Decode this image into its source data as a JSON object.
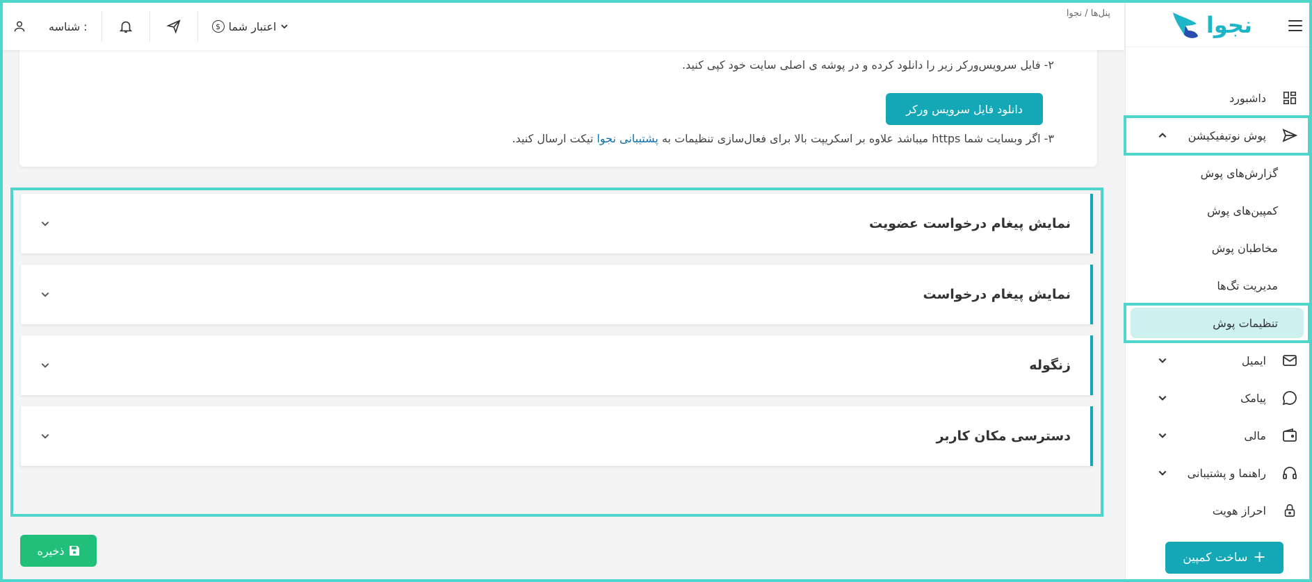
{
  "brand": {
    "logo_text": "نجوا",
    "accent": "#14a8b7",
    "outline": "#4fd6cc",
    "save_color": "#20c07a"
  },
  "topbar": {
    "breadcrumb": "پنل‌ها / نجوا",
    "id_label": "شناسه :",
    "credit_label": "اعتبار شما",
    "icons": [
      "user-icon",
      "bell-icon",
      "send-icon",
      "coin-icon",
      "chevron-down-icon"
    ]
  },
  "sidebar": {
    "items": [
      {
        "label": "داشبورد",
        "icon": "dashboard-icon"
      },
      {
        "label": "پوش نوتیفیکیشن",
        "icon": "send-icon",
        "expanded": true
      },
      {
        "label": "گزارش‌های پوش"
      },
      {
        "label": "کمپین‌های پوش"
      },
      {
        "label": "مخاطبان پوش"
      },
      {
        "label": "مدیریت تگ‌ها"
      },
      {
        "label": "تنظیمات پوش",
        "active": true
      },
      {
        "label": "ایمیل",
        "icon": "mail-icon"
      },
      {
        "label": "پیامک",
        "icon": "chat-icon"
      },
      {
        "label": "مالی",
        "icon": "wallet-icon"
      },
      {
        "label": "راهنما و پشتیبانی",
        "icon": "headset-icon"
      },
      {
        "label": "احراز هویت",
        "icon": "lock-icon"
      }
    ],
    "create_campaign": "ساخت کمپین"
  },
  "info": {
    "step2": "۲- فایل سرویس‌ورکر زیر را دانلود کرده و در پوشه ی اصلی سایت خود کپی کنید.",
    "download_button": "دانلود فایل سرویس ورکر",
    "step3_before": "۳- اگر وبسایت شما https میباشد علاوه بر اسکریپت بالا برای فعال‌سازی تنظیمات به",
    "step3_link": "پشتیبانی نجوا",
    "step3_after": "تیکت ارسال کنید."
  },
  "accordions": [
    {
      "title": "نمایش پیغام درخواست عضویت"
    },
    {
      "title": "نمایش پیغام درخواست"
    },
    {
      "title": "زنگوله"
    },
    {
      "title": "دسترسی مکان کاربر"
    }
  ],
  "save_button": "ذخیره"
}
